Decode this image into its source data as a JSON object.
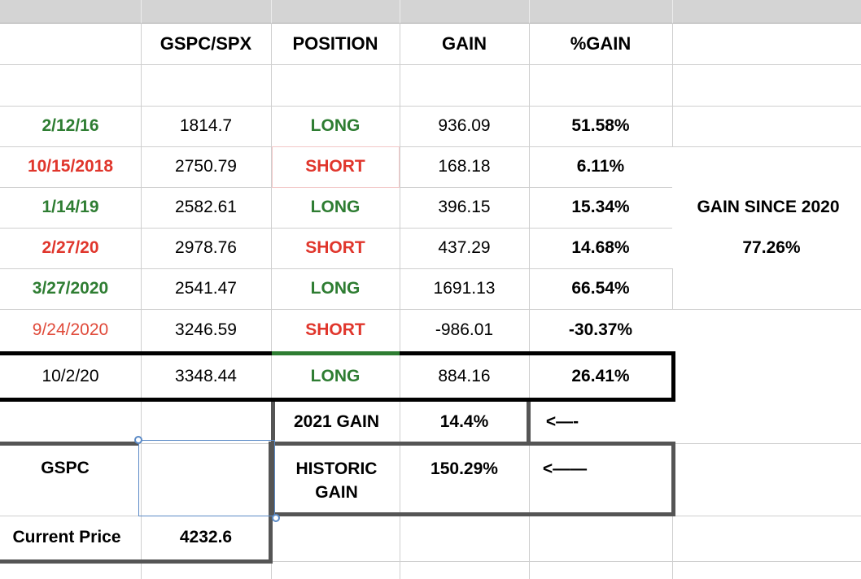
{
  "sheet": {
    "headers": {
      "index": "GSPC/SPX",
      "position": "POSITION",
      "gain": "GAIN",
      "pct_gain": "%GAIN"
    },
    "trades": [
      {
        "date": "2/12/16",
        "price": "1814.7",
        "position": "LONG",
        "gain": "936.09",
        "pct": "51.58%"
      },
      {
        "date": "10/15/2018",
        "price": "2750.79",
        "position": "SHORT",
        "gain": "168.18",
        "pct": "6.11%"
      },
      {
        "date": "1/14/19",
        "price": "2582.61",
        "position": "LONG",
        "gain": "396.15",
        "pct": "15.34%"
      },
      {
        "date": "2/27/20",
        "price": "2978.76",
        "position": "SHORT",
        "gain": "437.29",
        "pct": "14.68%"
      },
      {
        "date": "3/27/2020",
        "price": "2541.47",
        "position": "LONG",
        "gain": "1691.13",
        "pct": "66.54%"
      },
      {
        "date": "9/24/2020",
        "price": "3246.59",
        "position": "SHORT",
        "gain": "-986.01",
        "pct": "-30.37%"
      },
      {
        "date": "10/2/20",
        "price": "3348.44",
        "position": "LONG",
        "gain": "884.16",
        "pct": "26.41%"
      }
    ],
    "side_summary": {
      "label": "GAIN SINCE 2020",
      "value": "77.26%"
    },
    "gain_2021": {
      "label": "2021 GAIN",
      "value": "14.4%",
      "arrow": "<—-"
    },
    "historic": {
      "label_line1": "HISTORIC",
      "label_line2": "GAIN",
      "value": "150.29%",
      "arrow": "<——"
    },
    "gspc_label": "GSPC",
    "current_price": {
      "label": "Current Price",
      "value": "4232.6"
    }
  },
  "colors": {
    "long": "#2e7d32",
    "short": "#e0362c",
    "selection": "#5b8ac6"
  }
}
